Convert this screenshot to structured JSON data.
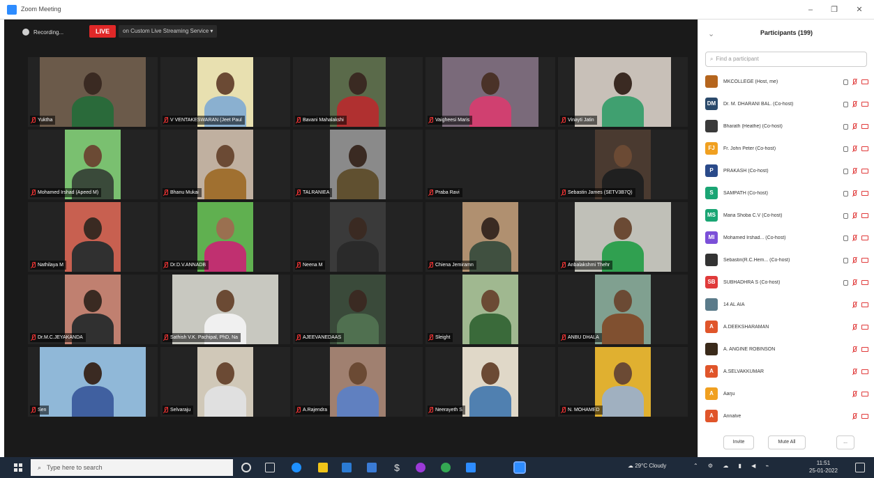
{
  "window": {
    "title": "Zoom Meeting",
    "minimize_glyph": "–",
    "maximize_glyph": "❐",
    "close_glyph": "✕"
  },
  "topbar": {
    "recording_label": "Recording...",
    "live_label": "LIVE",
    "stream_label": "on Custom Live Streaming Service ▾"
  },
  "gallery": [
    {
      "name": "Yuktha"
    },
    {
      "name": "V VENTAKESWARAN (Jeet Paul"
    },
    {
      "name": "Bavani Mahalakshi"
    },
    {
      "name": "Vaigheesi Maris"
    },
    {
      "name": "Vinayti Jatin"
    },
    {
      "name": "Mohamed Irshad (Apeed M)"
    },
    {
      "name": "Bhanu Mukai"
    },
    {
      "name": "TALRANIEA"
    },
    {
      "name": "Praba Ravi"
    },
    {
      "name": "Sebastin James (SETV3B7Q)"
    },
    {
      "name": "Nathilaya M"
    },
    {
      "name": "Dr.D.V.ANNADB"
    },
    {
      "name": "Neena M"
    },
    {
      "name": "Chiena Jemiramn"
    },
    {
      "name": "Anbalakshmi Thehr"
    },
    {
      "name": "Dr.M.C.JEYAKANDA"
    },
    {
      "name": "Sathish V.K. Pachipal, PhD, Na"
    },
    {
      "name": "AJEEVANEDAAS"
    },
    {
      "name": "Sleight"
    },
    {
      "name": "ANBU DHALA"
    },
    {
      "name": "Sen"
    },
    {
      "name": "Selvaraju"
    },
    {
      "name": "A.Rajendra"
    },
    {
      "name": "Neerayeth S"
    },
    {
      "name": "N. MOHAMED"
    }
  ],
  "participants_panel": {
    "title": "Participants (199)",
    "collapse_glyph": "⌄",
    "search_placeholder": "Find a participant",
    "participants": [
      {
        "avatar_text": "",
        "name": "MKCOLLEGE (Host, me)",
        "avatar_color": "#b5651d"
      },
      {
        "avatar_text": "DM",
        "name": "Dr. M. DHARANI BAL. (Co-host)",
        "avatar_color": "#2b4a6b"
      },
      {
        "avatar_text": "",
        "name": "Bharath (Heathe) (Co-host)",
        "avatar_color": "#3a3a3a"
      },
      {
        "avatar_text": "FJ",
        "name": "Fr. John Peter (Co-host)",
        "avatar_color": "#f0a020"
      },
      {
        "avatar_text": "P",
        "name": "PRAKASH (Co-host)",
        "avatar_color": "#2a4a8a"
      },
      {
        "avatar_text": "S",
        "name": "SAMPATH (Co-host)",
        "avatar_color": "#1aa574"
      },
      {
        "avatar_text": "MS",
        "name": "Maria Shoba C.V (Co-host)",
        "avatar_color": "#1aa574"
      },
      {
        "avatar_text": "MI",
        "name": "Mohamed Irshad... (Co-host)",
        "avatar_color": "#7b4fd8"
      },
      {
        "avatar_text": "",
        "name": "Sebastin(R.C.Hem... (Co-host)",
        "avatar_color": "#333333"
      },
      {
        "avatar_text": "SB",
        "name": "SUBHADHRA S (Co-host)",
        "avatar_color": "#e03a3a"
      },
      {
        "avatar_text": "",
        "name": "14 AL AIA",
        "avatar_color": "#5b7b8a"
      },
      {
        "avatar_text": "A",
        "name": "A.DEEKSHARAMAN",
        "avatar_color": "#e0552a"
      },
      {
        "avatar_text": "",
        "name": "A. ANGINE ROBINSON",
        "avatar_color": "#3a2a1a"
      },
      {
        "avatar_text": "A",
        "name": "A.SELVAKKUMAR",
        "avatar_color": "#e0552a"
      },
      {
        "avatar_text": "A",
        "name": "Aarju",
        "avatar_color": "#f0a020"
      },
      {
        "avatar_text": "A",
        "name": "Annalve",
        "avatar_color": "#e0552a"
      }
    ],
    "invite_label": "Invite",
    "mute_all_label": "Mute All",
    "more_label": "..."
  },
  "taskbar": {
    "search_placeholder": "Type here to search",
    "weather": "29°C  Cloudy",
    "time": "11:51",
    "date": "25-01-2022"
  }
}
